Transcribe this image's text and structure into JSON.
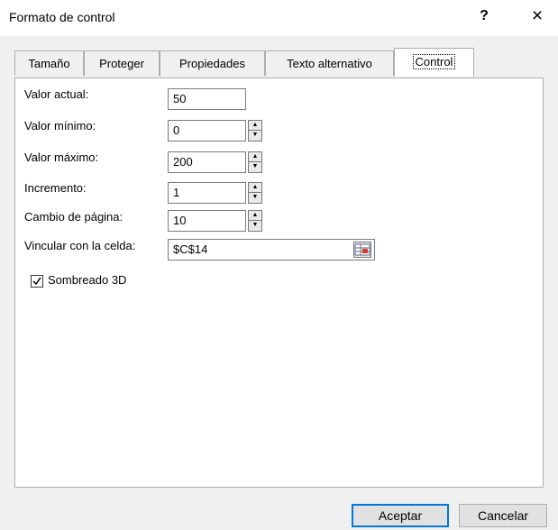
{
  "window": {
    "title": "Formato de control",
    "help": "?",
    "close": "×"
  },
  "tabs": [
    {
      "label": "Tamaño",
      "active": false
    },
    {
      "label": "Proteger",
      "active": false
    },
    {
      "label": "Propiedades",
      "active": false
    },
    {
      "label": "Texto alternativo",
      "active": false
    },
    {
      "label": "Control",
      "active": true
    }
  ],
  "control": {
    "current_value": {
      "label": "Valor actual:",
      "value": "50"
    },
    "min_value": {
      "label": "Valor mínimo:",
      "value": "0"
    },
    "max_value": {
      "label": "Valor máximo:",
      "value": "200"
    },
    "increment": {
      "label": "Incremento:",
      "value": "1"
    },
    "page_change": {
      "label": "Cambio de página:",
      "value": "10"
    },
    "cell_link": {
      "label": "Vincular con la celda:",
      "value": "$C$14"
    },
    "shading_3d": {
      "label": "Sombreado 3D",
      "checked": true
    },
    "spin_up": "▲",
    "spin_down": "▼"
  },
  "buttons": {
    "ok": "Aceptar",
    "cancel": "Cancelar"
  },
  "colors": {
    "accent": "#0078d7"
  }
}
